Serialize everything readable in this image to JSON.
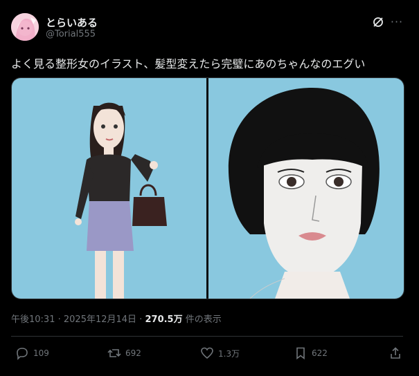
{
  "author": {
    "display_name": "とらいある",
    "handle": "@Torial555",
    "avatar_icon": "avatar-icon"
  },
  "header": {
    "grok_icon": "grok-icon",
    "more_icon": "more-icon"
  },
  "tweet": {
    "text": "よく見る整形女のイラスト、髪型変えたら完璧にあのちゃんなのエグい"
  },
  "meta": {
    "time": "午後10:31",
    "separator1": "·",
    "date": "2025年12月14日",
    "separator2": "·",
    "views_count": "270.5万",
    "views_label": "件の表示"
  },
  "actions": {
    "reply_count": "109",
    "retweet_count": "692",
    "like_count": "1.3万",
    "bookmark_count": "622"
  },
  "colors": {
    "background": "#000000",
    "text": "#e7e9ea",
    "muted": "#71767b",
    "image_bg": "#89c8df"
  }
}
